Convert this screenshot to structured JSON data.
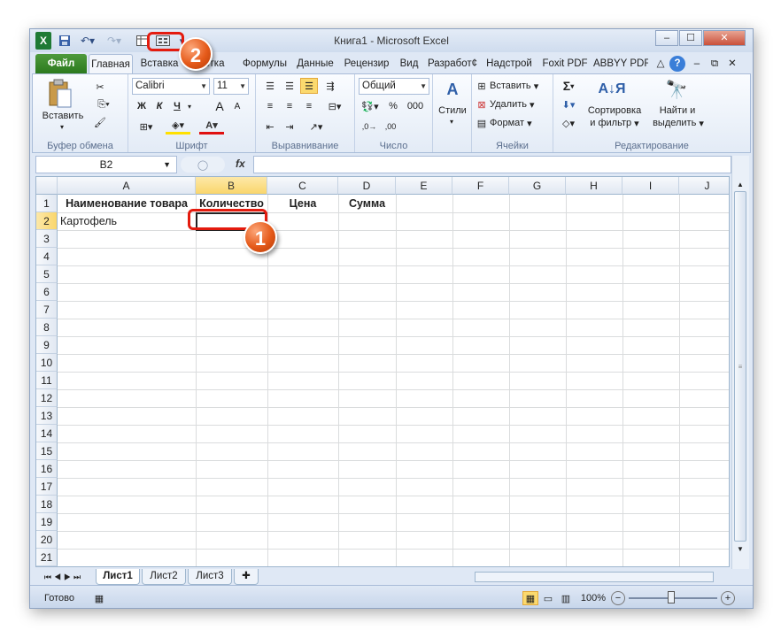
{
  "window": {
    "title": "Книга1  -  Microsoft Excel"
  },
  "quick_access": {
    "excel_icon": "excel-logo-icon",
    "save_icon": "save-icon",
    "undo_icon": "undo-icon",
    "redo_icon": "redo-icon",
    "btn1_icon": "table-form-icon",
    "btn2_icon": "form-icon"
  },
  "window_controls": {
    "minimize": "–",
    "maximize": "☐",
    "close": "✕"
  },
  "tabs": [
    "Файл",
    "Главная",
    "Вставка",
    "Разметка",
    "Формулы",
    "Данные",
    "Рецензир",
    "Вид",
    "Разработч",
    "Надстрой",
    "Foxit PDF",
    "ABBYY PDF"
  ],
  "tab_visible": [
    "Файл",
    "Главная",
    "Вставка",
    "етка",
    "Формулы",
    "Данные",
    "Рецензир",
    "Вид",
    "Разработ¢",
    "Надстрой",
    "Foxit PDF",
    "ABBYY PDF"
  ],
  "ribbon": {
    "clipboard": {
      "label": "Буфер обмена",
      "paste": "Вставить"
    },
    "font": {
      "label": "Шрифт",
      "name": "Calibri",
      "size": "11",
      "bold": "Ж",
      "italic": "К",
      "underline": "Ч",
      "grow": "A",
      "shrink": "A"
    },
    "alignment": {
      "label": "Выравнивание"
    },
    "number": {
      "label": "Число",
      "format": "Общий",
      "percent": "%",
      "thousands": "000"
    },
    "styles": {
      "label": "Стили"
    },
    "cells": {
      "label": "Ячейки",
      "insert": "Вставить",
      "delete": "Удалить",
      "format": "Формат"
    },
    "editing": {
      "label": "Редактирование",
      "sum": "Σ",
      "sort1": "Сортировка",
      "sort2": "и фильтр",
      "find1": "Найти и",
      "find2": "выделить"
    }
  },
  "formula_bar": {
    "name_box": "B2",
    "fx": "fx",
    "value": ""
  },
  "columns": [
    "A",
    "B",
    "C",
    "D",
    "E",
    "F",
    "G",
    "H",
    "I",
    "J"
  ],
  "rows": [
    "1",
    "2",
    "3",
    "4",
    "5",
    "6",
    "7",
    "8",
    "9",
    "10",
    "11",
    "12",
    "13",
    "14",
    "15",
    "16",
    "17",
    "18",
    "19",
    "20",
    "21"
  ],
  "cells": {
    "A1": "Наименование товара",
    "B1": "Количество",
    "C1": "Цена",
    "D1": "Сумма",
    "A2": "Картофель"
  },
  "selected_cell": "B2",
  "sheets": [
    "Лист1",
    "Лист2",
    "Лист3"
  ],
  "status": {
    "ready": "Готово",
    "zoom": "100%",
    "minus": "−",
    "plus": "+"
  },
  "annotations": [
    "1",
    "2"
  ],
  "colors": {
    "file_tab": "#2c7a1e",
    "marker": "#e55a1a",
    "highlight": "#e41b0e",
    "selection": "#f9d66c"
  }
}
